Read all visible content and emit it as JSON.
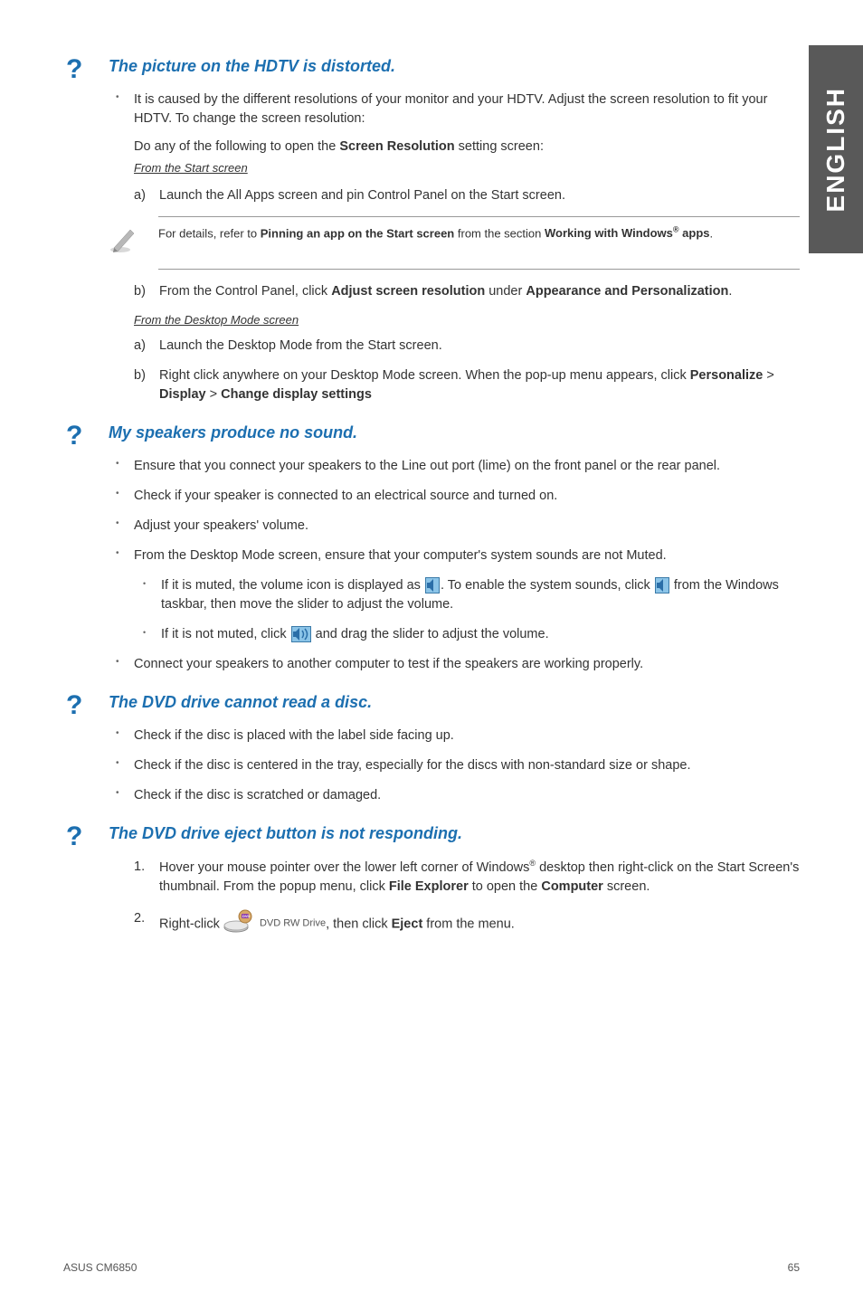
{
  "sideTab": "ENGLISH",
  "sections": [
    {
      "title": "The picture on the HDTV is distorted.",
      "bullets": [
        {
          "text": "It is caused by the different resolutions of your monitor and your HDTV. Adjust the screen resolution to fit your HDTV. To change the screen resolution:",
          "lead": "Do any of the following to open the ",
          "bold1": "Screen Resolution",
          "trail": " setting screen:",
          "sub1": "From the Start screen",
          "a_a": "Launch the All Apps screen and pin Control Panel on the Start screen.",
          "note_pre": "For details, refer to ",
          "note_b1": "Pinning an app on the Start screen",
          "note_mid": " from the section ",
          "note_b2": "Working with Windows",
          "note_b3": " apps",
          "b_b_pre": "From the Control Panel, click ",
          "b_b_bold": "Adjust screen resolution",
          "b_b_mid": " under ",
          "b_b_bold2": "Appearance and Personalization",
          "sub2": "From the Desktop Mode screen",
          "d_a": "Launch the Desktop Mode from the Start screen.",
          "d_b_pre": "Right click anywhere on your Desktop Mode screen. When the pop-up menu appears, click ",
          "d_b_b1": "Personalize",
          "d_b_gt1": " > ",
          "d_b_b2": "Display",
          "d_b_gt2": " > ",
          "d_b_b3": "Change display settings"
        }
      ]
    },
    {
      "title": "My speakers produce no sound.",
      "b1": "Ensure that you connect your speakers to the Line out port (lime) on the front panel or the rear panel.",
      "b2": "Check if your speaker is connected to an electrical source and turned on.",
      "b3": "Adjust your speakers' volume.",
      "b4": "From the Desktop Mode screen, ensure that your computer's system sounds are not Muted.",
      "b4_i1_pre": "If it is muted, the volume icon is displayed as ",
      "b4_i1_mid": ". To enable the system sounds, click ",
      "b4_i1_post": " from the Windows taskbar, then move the slider to adjust the volume.",
      "b4_i2_pre": "If it is not muted, click ",
      "b4_i2_post": " and drag the slider to adjust the volume.",
      "b5": "Connect your speakers to another computer to test if the speakers are working properly."
    },
    {
      "title": "The DVD drive cannot read a disc.",
      "b1": "Check if the disc is placed with the label side facing up.",
      "b2": "Check if the disc is centered in the tray, especially for the discs with non-standard size or shape.",
      "b3": "Check if the disc is scratched or damaged."
    },
    {
      "title": "The DVD drive eject button is not responding.",
      "n1_pre": "Hover your mouse pointer over the lower left corner of Windows",
      "n1_mid": " desktop then right-click on the Start Screen's thumbnail. From the popup menu, click ",
      "n1_b1": "File Explorer",
      "n1_mid2": " to open the ",
      "n1_b2": "Computer",
      "n1_post": " screen.",
      "n2_pre": "Right-click ",
      "n2_label": "DVD RW Drive",
      "n2_mid": ", then click ",
      "n2_b1": "Eject",
      "n2_post": " from the menu."
    }
  ],
  "footer": {
    "left": "ASUS CM6850",
    "right": "65"
  }
}
